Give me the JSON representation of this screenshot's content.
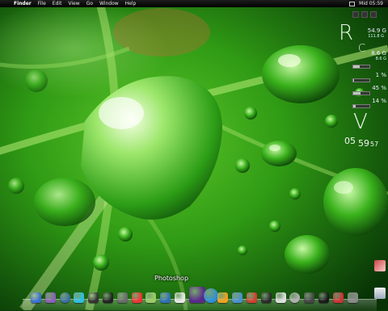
{
  "menubar": {
    "apple_glyph": "",
    "items": [
      "Finder",
      "File",
      "Edit",
      "View",
      "Go",
      "Window",
      "Help"
    ],
    "clock": "Mid 05:59"
  },
  "widgets": {
    "disk_letter": "R",
    "disk_total": "54.9 G",
    "disk_sub": "111.8 G",
    "c_letter": "C",
    "c_total": "8.6 G",
    "c_sub": "8.6 G",
    "cpu_percent_text": "1 %",
    "mem_percent_text": "45 %",
    "other_percent_text": "14 %",
    "cpu_fraction": 0.01,
    "mem_fraction": 0.45,
    "other_fraction": 0.14,
    "time_letter": "V",
    "time_hour": "05",
    "time_min": "59",
    "time_sec": "57"
  },
  "dock": {
    "hover_label": "Photoshop",
    "icons": [
      "finder-icon",
      "dashboard-icon",
      "safari-icon",
      "itunes-icon",
      "movie-icon",
      "film-icon",
      "photo-icon",
      "pdf-icon",
      "app-icon",
      "wordpress-icon",
      "scissors-icon",
      "photoshop-icon",
      "globe-icon",
      "pinwheel-icon",
      "mail-icon",
      "fruit-icon",
      "terminal-icon",
      "chat-icon",
      "cd-icon",
      "clock-icon",
      "camera-icon",
      "gear-icon",
      "trash-icon"
    ]
  },
  "colors": {
    "leaf_dark": "#0f4a0a",
    "leaf_light": "#6fd62f",
    "menubar": "#111111"
  }
}
